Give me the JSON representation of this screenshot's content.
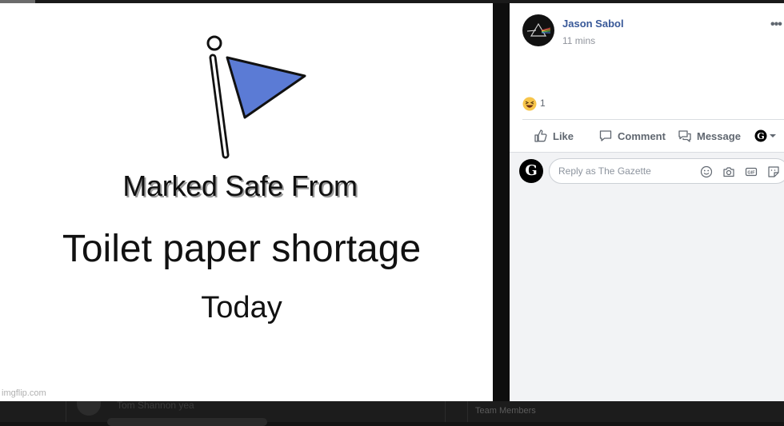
{
  "meme": {
    "line1": "Marked Safe From",
    "line2": "Toilet paper shortage",
    "line3": "Today",
    "watermark": "imgflip.com",
    "flag_color": "#5b7bd5"
  },
  "post": {
    "author": "Jason Sabol",
    "time": "11 mins",
    "more_icon": "•••",
    "reaction": {
      "icon": "haha-emoji-icon",
      "count": "1"
    },
    "actions": {
      "like": "Like",
      "comment": "Comment",
      "message": "Message"
    },
    "reply": {
      "avatar_letter": "G",
      "placeholder": "Reply as The Gazette",
      "tools": [
        "emoji-icon",
        "camera-icon",
        "gif-icon",
        "sticker-icon"
      ]
    },
    "link_color": "#385898"
  },
  "background": {
    "comment_ghost": "Tom Shannon yea",
    "team_ghost": "Team Members"
  }
}
